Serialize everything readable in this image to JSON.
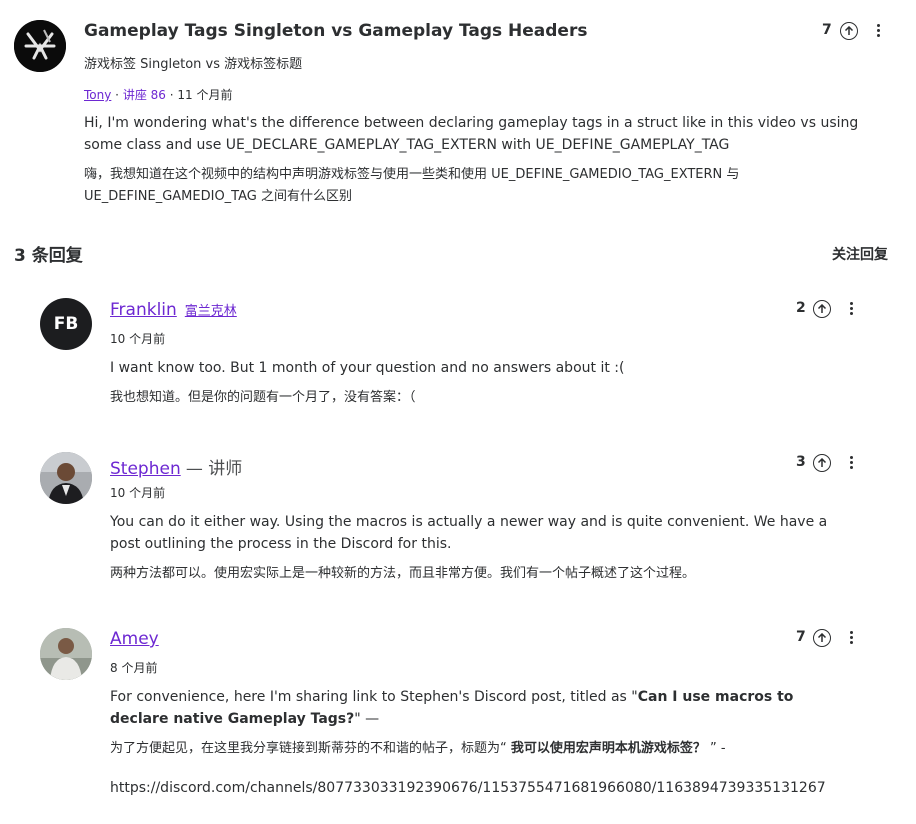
{
  "question": {
    "title": "Gameplay Tags Singleton vs Gameplay Tags Headers",
    "title_zh": "游戏标签 Singleton vs 游戏标签标题",
    "author": "Tony",
    "lecture": "讲座 86",
    "sep": "·",
    "time": "11 个月前",
    "body": "Hi, I'm wondering what's the difference between declaring gameplay tags in a struct like in this video vs using some class and use UE_DECLARE_GAMEPLAY_TAG_EXTERN with UE_DEFINE_GAMEPLAY_TAG",
    "body_zh": "嗨，我想知道在这个视频中的结构中声明游戏标签与使用一些类和使用 UE_DEFINE_GAMEDIO_TAG_EXTERN 与 UE_DEFINE_GAMEDIO_TAG 之间有什么区别",
    "upvotes": "7"
  },
  "replies_header": {
    "count_label": "3 条回复",
    "follow_label": "关注回复"
  },
  "replies": [
    {
      "initials": "FB",
      "name": "Franklin",
      "name_zh": "富兰克林",
      "time": "10 个月前",
      "upvotes": "2",
      "body": "I want know too. But 1 month of your question and no answers about it :(",
      "body_zh": "我也想知道。但是你的问题有一个月了，没有答案：（"
    },
    {
      "name": "Stephen",
      "role": "— 讲师",
      "time": "10 个月前",
      "upvotes": "3",
      "body": "You can do it either way. Using the macros is actually a newer way and is quite convenient. We have a post outlining the process in the Discord for this.",
      "body_zh": "两种方法都可以。使用宏实际上是一种较新的方法，而且非常方便。我们有一个帖子概述了这个过程。"
    },
    {
      "name": "Amey",
      "time": "8 个月前",
      "upvotes": "7",
      "body_pre": "For convenience, here I'm sharing link to Stephen's Discord post, titled as \"",
      "body_bold": "Can I use macros to declare native Gameplay Tags?",
      "body_post": "\" —",
      "body_zh_pre": "为了方便起见，在这里我分享链接到斯蒂芬的不和谐的帖子，标题为“ ",
      "body_zh_bold": "我可以使用宏声明本机游戏标签？",
      "body_zh_post": " ” -",
      "link": "https://discord.com/channels/807733033192390676/1153755471681966080/1163894739335131267"
    }
  ]
}
